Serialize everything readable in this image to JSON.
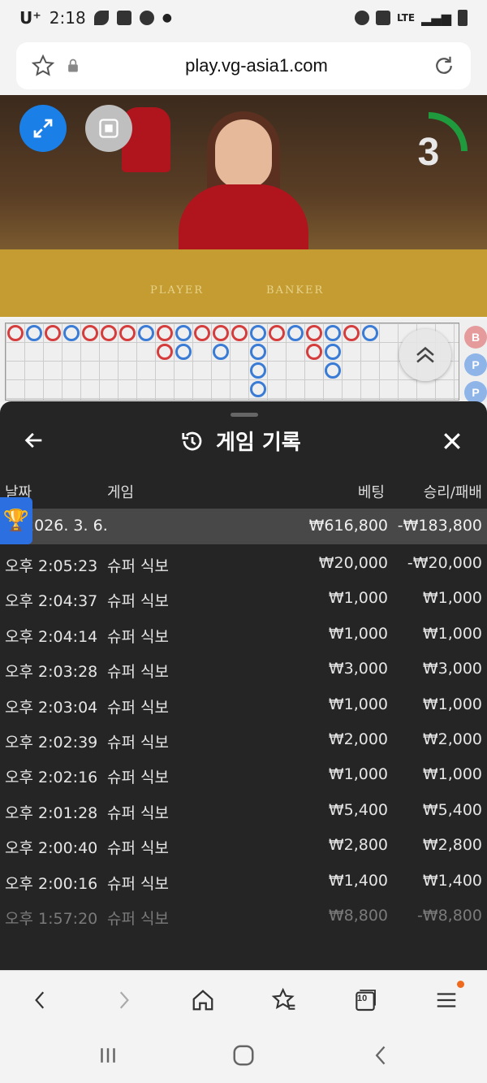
{
  "status_bar": {
    "carrier": "U⁺",
    "time": "2:18",
    "network": "LTE"
  },
  "browser": {
    "url": "play.vg-asia1.com"
  },
  "video": {
    "player_label": "PLAYER",
    "banker_label": "BANKER",
    "countdown": "3"
  },
  "road_side": [
    "B",
    "P",
    "P"
  ],
  "panel": {
    "title": "게임 기록",
    "columns": {
      "date": "날짜",
      "game": "게임",
      "bet": "베팅",
      "win_loss": "승리/패배"
    },
    "summary": {
      "date": "2026. 3. 6.",
      "bet": "₩616,800",
      "win_loss": "-₩183,800"
    },
    "rows": [
      {
        "time": "오후 2:05:23",
        "game": "슈퍼 식보",
        "bet": "₩20,000",
        "win_loss": "-₩20,000"
      },
      {
        "time": "오후 2:04:37",
        "game": "슈퍼 식보",
        "bet": "₩1,000",
        "win_loss": "₩1,000"
      },
      {
        "time": "오후 2:04:14",
        "game": "슈퍼 식보",
        "bet": "₩1,000",
        "win_loss": "₩1,000"
      },
      {
        "time": "오후 2:03:28",
        "game": "슈퍼 식보",
        "bet": "₩3,000",
        "win_loss": "₩3,000"
      },
      {
        "time": "오후 2:03:04",
        "game": "슈퍼 식보",
        "bet": "₩1,000",
        "win_loss": "₩1,000"
      },
      {
        "time": "오후 2:02:39",
        "game": "슈퍼 식보",
        "bet": "₩2,000",
        "win_loss": "₩2,000"
      },
      {
        "time": "오후 2:02:16",
        "game": "슈퍼 식보",
        "bet": "₩1,000",
        "win_loss": "₩1,000"
      },
      {
        "time": "오후 2:01:28",
        "game": "슈퍼 식보",
        "bet": "₩5,400",
        "win_loss": "₩5,400"
      },
      {
        "time": "오후 2:00:40",
        "game": "슈퍼 식보",
        "bet": "₩2,800",
        "win_loss": "₩2,800"
      },
      {
        "time": "오후 2:00:16",
        "game": "슈퍼 식보",
        "bet": "₩1,400",
        "win_loss": "₩1,400"
      },
      {
        "time": "오후 1:57:20",
        "game": "슈퍼 식보",
        "bet": "₩8,800",
        "win_loss": "-₩8,800"
      }
    ]
  },
  "browser_nav": {
    "tab_count": "10"
  },
  "colors": {
    "accent": "#1a7fe6",
    "banker": "#d53d3d",
    "player": "#3a7bd5",
    "panel_bg": "#252525"
  }
}
